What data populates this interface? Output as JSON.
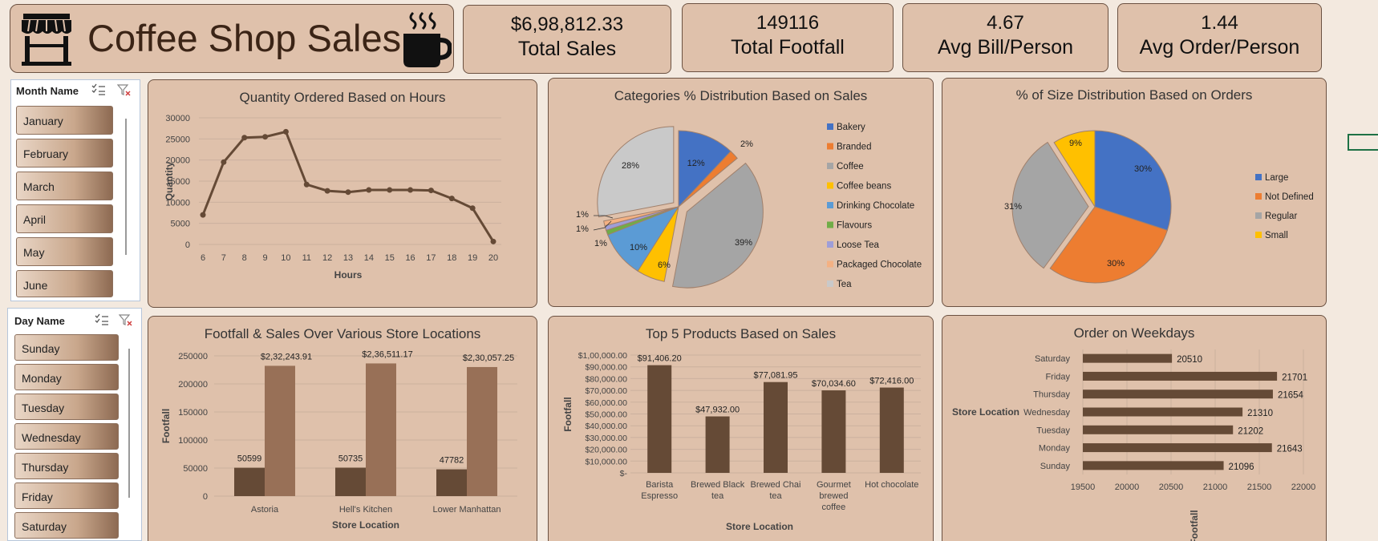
{
  "header": {
    "title": "Coffee Shop Sales"
  },
  "kpis": [
    {
      "value": "$6,98,812.33",
      "label": "Total Sales"
    },
    {
      "value": "149116",
      "label": "Total Footfall"
    },
    {
      "value": "4.67",
      "label": "Avg Bill/Person"
    },
    {
      "value": "1.44",
      "label": "Avg Order/Person"
    }
  ],
  "slicers": {
    "month": {
      "title": "Month Name",
      "items": [
        "January",
        "February",
        "March",
        "April",
        "May",
        "June"
      ]
    },
    "day": {
      "title": "Day Name",
      "items": [
        "Sunday",
        "Monday",
        "Tuesday",
        "Wednesday",
        "Thursday",
        "Friday",
        "Saturday"
      ]
    }
  },
  "colors": {
    "brown_dark": "#654a36",
    "brown_light": "#987057",
    "panel": "#dfc1ab"
  },
  "chart_data": [
    {
      "id": "hours",
      "type": "line",
      "title": "Quantity Ordered Based on Hours",
      "xlabel": "Hours",
      "ylabel": "Quantity",
      "x": [
        "6",
        "7",
        "8",
        "9",
        "10",
        "11",
        "12",
        "13",
        "14",
        "15",
        "16",
        "17",
        "18",
        "19",
        "20"
      ],
      "values": [
        7000,
        19500,
        25300,
        25500,
        26700,
        14200,
        12700,
        12400,
        12900,
        12900,
        12900,
        12800,
        10900,
        8600,
        700
      ],
      "ylim": [
        0,
        30000
      ],
      "yticks": [
        "0",
        "5000",
        "10000",
        "15000",
        "20000",
        "25000",
        "30000"
      ],
      "color": "#654a36"
    },
    {
      "id": "categories",
      "type": "pie",
      "title": "Categories % Distribution Based on Sales",
      "labels": [
        "Bakery",
        "Branded",
        "Coffee",
        "Coffee beans",
        "Drinking Chocolate",
        "Flavours",
        "Loose Tea",
        "Packaged Chocolate",
        "Tea"
      ],
      "values": [
        12,
        2,
        39,
        6,
        10,
        1,
        1,
        1,
        28
      ],
      "data_labels": [
        "12%",
        "2%",
        "39%",
        "6%",
        "10%",
        "1%",
        "1%",
        "1%",
        "28%"
      ],
      "colors": [
        "#4472c4",
        "#ed7d31",
        "#a5a5a5",
        "#ffc000",
        "#5b9bd5",
        "#70ad47",
        "#9e9ed8",
        "#f4b183",
        "#c9c9c9"
      ],
      "legend": "right"
    },
    {
      "id": "sizes",
      "type": "pie",
      "title": "% of Size Distribution Based on Orders",
      "labels": [
        "Large",
        "Not Defined",
        "Regular",
        "Small"
      ],
      "values": [
        30,
        30,
        31,
        9
      ],
      "data_labels": [
        "30%",
        "30%",
        "31%",
        "9%"
      ],
      "colors": [
        "#4472c4",
        "#ed7d31",
        "#a5a5a5",
        "#ffc000"
      ],
      "legend": "right"
    },
    {
      "id": "locations",
      "type": "bar",
      "title": "Footfall & Sales Over Various Store Locations",
      "xlabel": "Store Location",
      "ylabel": "Footfall",
      "categories": [
        "Astoria",
        "Hell's Kitchen",
        "Lower Manhattan"
      ],
      "series": [
        {
          "values": [
            50599,
            50735,
            47782
          ],
          "labels": [
            "50599",
            "50735",
            "47782"
          ],
          "color": "#654a36"
        },
        {
          "values": [
            232243.91,
            236511.17,
            230057.25
          ],
          "labels": [
            "$2,32,243.91",
            "$2,36,511.17",
            "$2,30,057.25"
          ],
          "color": "#987057"
        }
      ],
      "ylim": [
        0,
        250000
      ],
      "yticks": [
        "0",
        "50000",
        "100000",
        "150000",
        "200000",
        "250000"
      ]
    },
    {
      "id": "products",
      "type": "bar",
      "title": "Top 5 Products Based on Sales",
      "xlabel": "Store Location",
      "ylabel": "Footfall",
      "categories": [
        [
          "Barista",
          "Espresso"
        ],
        [
          "Brewed Black",
          "tea"
        ],
        [
          "Brewed Chai",
          "tea"
        ],
        [
          "Gourmet",
          "brewed",
          "coffee"
        ],
        [
          "Hot chocolate"
        ]
      ],
      "values": [
        91406.2,
        47932.0,
        77081.95,
        70034.6,
        72416.0
      ],
      "labels": [
        "$91,406.20",
        "$47,932.00",
        "$77,081.95",
        "$70,034.60",
        "$72,416.00"
      ],
      "ylim": [
        0,
        100000
      ],
      "yticks": [
        "$-",
        "$10,000.00",
        "$20,000.00",
        "$30,000.00",
        "$40,000.00",
        "$50,000.00",
        "$60,000.00",
        "$70,000.00",
        "$80,000.00",
        "$90,000.00",
        "$1,00,000.00"
      ],
      "color": "#654a36"
    },
    {
      "id": "weekdays",
      "type": "bar",
      "orientation": "horizontal",
      "title": "Order on Weekdays",
      "xlabel": "Footfall",
      "ylabel": "Store Location",
      "categories": [
        "Saturday",
        "Friday",
        "Thursday",
        "Wednesday",
        "Tuesday",
        "Monday",
        "Sunday"
      ],
      "values": [
        20510,
        21701,
        21654,
        21310,
        21202,
        21643,
        21096
      ],
      "labels": [
        "20510",
        "21701",
        "21654",
        "21310",
        "21202",
        "21643",
        "21096"
      ],
      "xlim": [
        19500,
        22000
      ],
      "xticks": [
        "19500",
        "20000",
        "20500",
        "21000",
        "21500",
        "22000"
      ],
      "color": "#654a36"
    }
  ]
}
